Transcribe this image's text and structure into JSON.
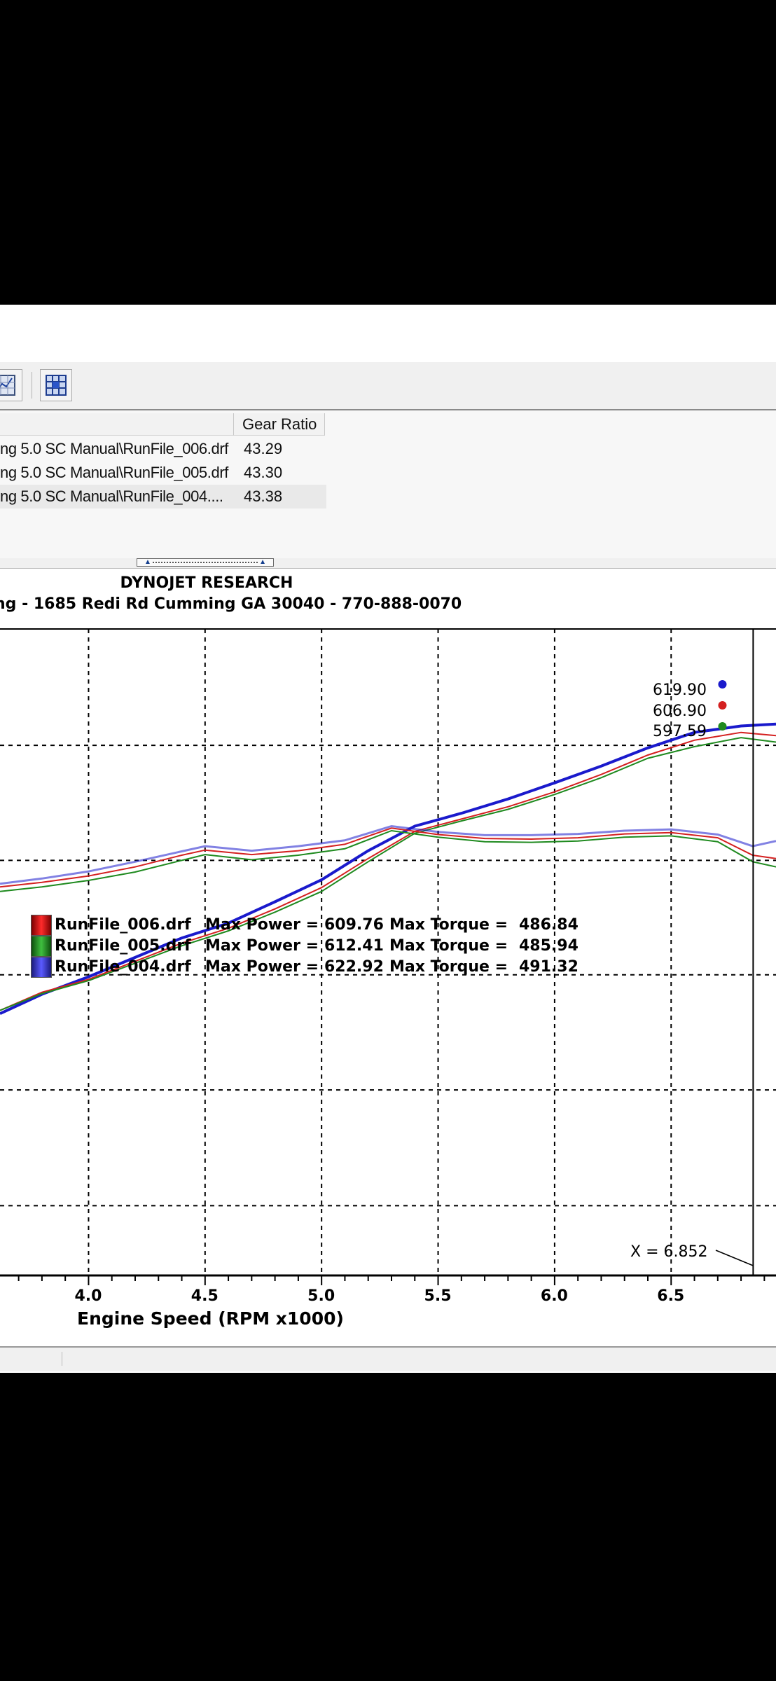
{
  "file_list": {
    "gear_ratio_header": "Gear Ratio",
    "rows": [
      {
        "path": "ng 5.0 SC Manual\\RunFile_006.drf",
        "gear": "43.29"
      },
      {
        "path": "ng 5.0 SC Manual\\RunFile_005.drf",
        "gear": "43.30"
      },
      {
        "path": "ng 5.0 SC Manual\\RunFile_004....",
        "gear": "43.38"
      }
    ]
  },
  "toolbar": {
    "icons": [
      "graph-icon",
      "grid-icon"
    ]
  },
  "colors": {
    "run_006": "#d42020",
    "run_005": "#1f8a1f",
    "run_004": "#1a1acc",
    "grid": "#000000"
  },
  "chart_data": {
    "type": "line",
    "title": "DYNOJET RESEARCH",
    "subtitle": "ng - 1685 Redi Rd Cumming GA 30040 - 770-888-0070",
    "xlabel": "Engine Speed (RPM x1000)",
    "xlim": [
      3.62,
      6.95
    ],
    "x_ticks": [
      "4.0",
      "4.5",
      "5.0",
      "5.5",
      "6.0",
      "6.5"
    ],
    "cursor": {
      "x": 6.852,
      "label": "X = 6.852"
    },
    "peak_labels": [
      {
        "value": "619.90",
        "series": "RunFile_004.drf"
      },
      {
        "value": "606.90",
        "series": "RunFile_006.drf"
      },
      {
        "value": "597.59",
        "series": "RunFile_005.drf"
      }
    ],
    "legend": [
      {
        "file": "RunFile_006.drf",
        "power_label": "Max Power =",
        "power": "609.76",
        "torque_label": "Max Torque =",
        "torque": "486.84"
      },
      {
        "file": "RunFile_005.drf",
        "power_label": "Max Power =",
        "power": "612.41",
        "torque_label": "Max Torque =",
        "torque": "485.94"
      },
      {
        "file": "RunFile_004.drf",
        "power_label": "Max Power =",
        "power": "622.92",
        "torque_label": "Max Torque =",
        "torque": "491.32"
      }
    ],
    "series": [
      {
        "name": "RunFile_004.drf",
        "kind": "power",
        "x": [
          3.62,
          3.8,
          4.0,
          4.2,
          4.4,
          4.6,
          4.8,
          5.0,
          5.2,
          5.4,
          5.6,
          5.8,
          6.0,
          6.2,
          6.4,
          6.6,
          6.8,
          6.95
        ],
        "y": [
          0.405,
          0.435,
          0.462,
          0.492,
          0.522,
          0.545,
          0.578,
          0.612,
          0.657,
          0.695,
          0.715,
          0.737,
          0.762,
          0.788,
          0.816,
          0.84,
          0.85,
          0.853
        ]
      },
      {
        "name": "RunFile_006.drf",
        "kind": "power",
        "x": [
          3.62,
          3.8,
          4.0,
          4.2,
          4.4,
          4.6,
          4.8,
          5.0,
          5.2,
          5.4,
          5.6,
          5.8,
          6.0,
          6.2,
          6.4,
          6.6,
          6.8,
          6.95
        ],
        "y": [
          0.41,
          0.438,
          0.458,
          0.486,
          0.514,
          0.537,
          0.567,
          0.6,
          0.645,
          0.687,
          0.706,
          0.725,
          0.748,
          0.775,
          0.805,
          0.828,
          0.84,
          0.835
        ]
      },
      {
        "name": "RunFile_005.drf",
        "kind": "power",
        "x": [
          3.62,
          3.8,
          4.0,
          4.2,
          4.4,
          4.6,
          4.8,
          5.0,
          5.2,
          5.4,
          5.6,
          5.8,
          6.0,
          6.2,
          6.4,
          6.6,
          6.8,
          6.95
        ],
        "y": [
          0.41,
          0.436,
          0.456,
          0.483,
          0.51,
          0.533,
          0.562,
          0.594,
          0.64,
          0.684,
          0.703,
          0.721,
          0.744,
          0.77,
          0.8,
          0.818,
          0.832,
          0.825
        ]
      },
      {
        "name": "RunFile_004.drf",
        "kind": "torque",
        "x": [
          3.62,
          3.8,
          4.0,
          4.2,
          4.4,
          4.5,
          4.7,
          4.9,
          5.1,
          5.3,
          5.5,
          5.7,
          5.9,
          6.1,
          6.3,
          6.5,
          6.7,
          6.85,
          6.95
        ],
        "y": [
          0.606,
          0.614,
          0.625,
          0.64,
          0.656,
          0.664,
          0.657,
          0.664,
          0.673,
          0.695,
          0.686,
          0.681,
          0.681,
          0.683,
          0.688,
          0.69,
          0.682,
          0.664,
          0.672
        ]
      },
      {
        "name": "RunFile_006.drf",
        "kind": "torque",
        "x": [
          3.62,
          3.8,
          4.0,
          4.2,
          4.4,
          4.5,
          4.7,
          4.9,
          5.1,
          5.3,
          5.5,
          5.7,
          5.9,
          6.1,
          6.3,
          6.5,
          6.7,
          6.85,
          6.95
        ],
        "y": [
          0.601,
          0.608,
          0.618,
          0.632,
          0.65,
          0.658,
          0.651,
          0.657,
          0.667,
          0.692,
          0.682,
          0.676,
          0.675,
          0.677,
          0.683,
          0.685,
          0.677,
          0.65,
          0.645
        ]
      },
      {
        "name": "RunFile_005.drf",
        "kind": "torque",
        "x": [
          3.62,
          3.8,
          4.0,
          4.2,
          4.4,
          4.5,
          4.7,
          4.9,
          5.1,
          5.3,
          5.5,
          5.7,
          5.9,
          6.1,
          6.3,
          6.5,
          6.7,
          6.85,
          6.95
        ],
        "y": [
          0.594,
          0.601,
          0.611,
          0.624,
          0.642,
          0.651,
          0.643,
          0.65,
          0.66,
          0.688,
          0.678,
          0.671,
          0.67,
          0.672,
          0.678,
          0.68,
          0.671,
          0.64,
          0.632
        ]
      }
    ]
  }
}
